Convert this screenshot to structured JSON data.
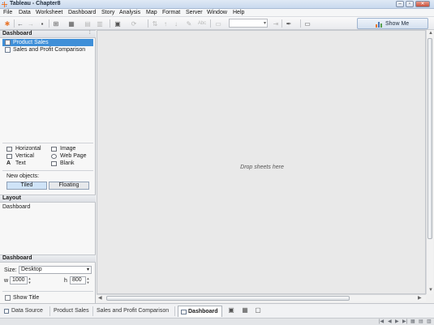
{
  "window": {
    "title": "Tableau - Chapter8"
  },
  "menu": [
    "File",
    "Data",
    "Worksheet",
    "Dashboard",
    "Story",
    "Analysis",
    "Map",
    "Format",
    "Server",
    "Window",
    "Help"
  ],
  "toolbar": {
    "show_me_label": "Show Me"
  },
  "dashboard_panel": {
    "header": "Dashboard",
    "sheets": [
      {
        "label": "Product Sales",
        "selected": true
      },
      {
        "label": "Sales and Profit Comparison",
        "selected": false
      }
    ],
    "objects": [
      {
        "label": "Horizontal",
        "icon": "horizontal-container-icon"
      },
      {
        "label": "Image",
        "icon": "image-icon"
      },
      {
        "label": "Vertical",
        "icon": "vertical-container-icon"
      },
      {
        "label": "Web Page",
        "icon": "web-page-icon"
      },
      {
        "label": "Text",
        "icon": "text-icon"
      },
      {
        "label": "Blank",
        "icon": "blank-icon"
      }
    ],
    "new_objects_label": "New objects:",
    "tiled_label": "Tiled",
    "floating_label": "Floating"
  },
  "layout_panel": {
    "header": "Layout",
    "item": "Dashboard"
  },
  "size_panel": {
    "header": "Dashboard",
    "size_label": "Size:",
    "size_value": "Desktop",
    "w_label": "w",
    "w_value": "1000",
    "h_label": "h",
    "h_value": "800",
    "show_title_label": "Show Title"
  },
  "canvas": {
    "placeholder": "Drop sheets here"
  },
  "tabs": [
    {
      "label": "Data Source",
      "active": false
    },
    {
      "label": "Product Sales",
      "active": false
    },
    {
      "label": "Sales and Profit Comparison",
      "active": false
    },
    {
      "label": "Dashboard 1",
      "active": true
    }
  ],
  "colors": {
    "accent": "#3f8fd8",
    "toggle_active": "#cfe3f7"
  }
}
